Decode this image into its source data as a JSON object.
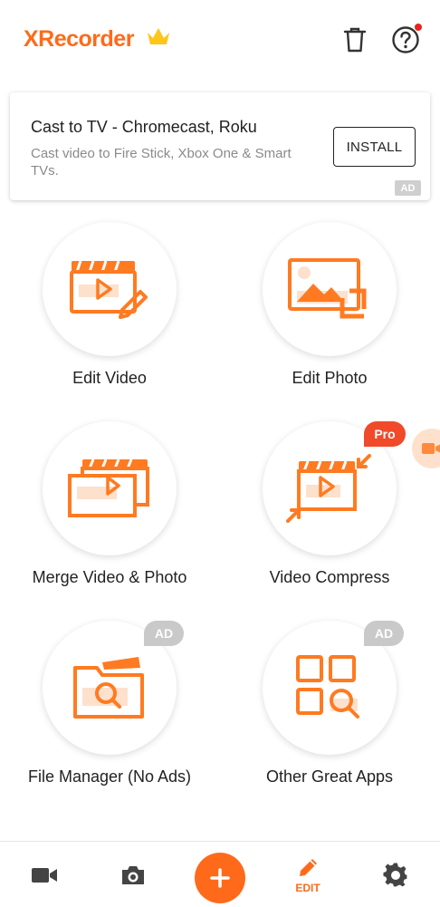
{
  "header": {
    "app_name": "XRecorder"
  },
  "ad": {
    "title": "Cast to TV - Chromecast, Roku",
    "subtitle": "Cast video to Fire Stick, Xbox One & Smart TVs.",
    "install_label": "INSTALL",
    "badge": "AD"
  },
  "tiles": [
    {
      "label": "Edit Video",
      "icon": "edit-video-icon"
    },
    {
      "label": "Edit Photo",
      "icon": "edit-photo-icon"
    },
    {
      "label": "Merge Video & Photo",
      "icon": "merge-icon"
    },
    {
      "label": "Video Compress",
      "icon": "compress-icon",
      "badge": "Pro"
    },
    {
      "label": "File Manager (No Ads)",
      "icon": "file-manager-icon",
      "badge": "AD"
    },
    {
      "label": "Other Great Apps",
      "icon": "apps-grid-icon",
      "badge": "AD"
    }
  ],
  "bottom_nav": {
    "edit_label": "EDIT",
    "active": "edit"
  },
  "colors": {
    "accent": "#ff6a1a",
    "pro_badge": "#f04a2a",
    "ad_badge": "#c9c9c9",
    "notification_dot": "#e8241c"
  }
}
